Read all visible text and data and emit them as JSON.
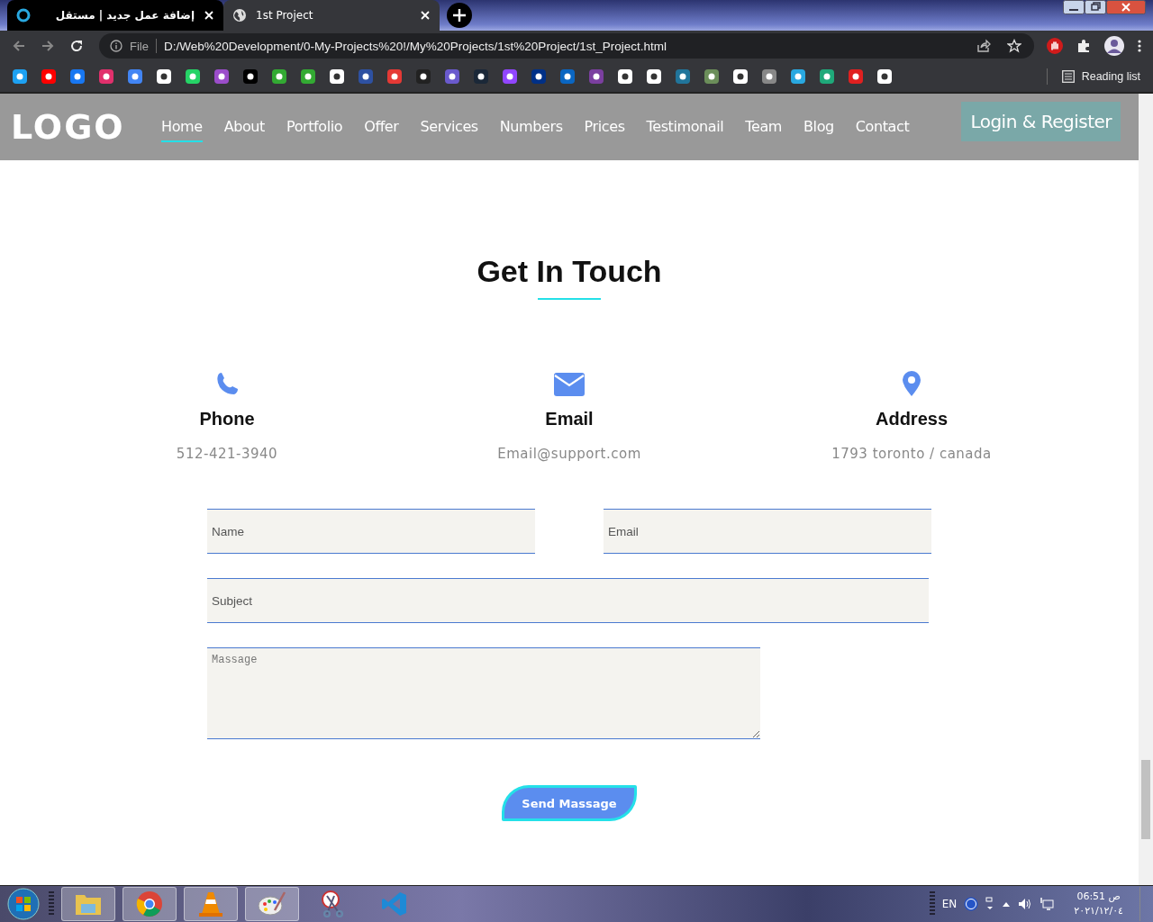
{
  "browser": {
    "tabs": [
      {
        "title": "إضافة عمل جديد | مستقل",
        "selected": false
      },
      {
        "title": "1st Project",
        "selected": true
      }
    ],
    "address": {
      "scheme": "File",
      "url": "D:/Web%20Development/0-My-Projects%20!/My%20Projects/1st%20Project/1st_Project.html"
    },
    "reading_list": "Reading list"
  },
  "nav": {
    "logo": "LOGO",
    "links": [
      {
        "label": "Home",
        "selected": true
      },
      {
        "label": "About",
        "selected": false
      },
      {
        "label": "Portfolio",
        "selected": false
      },
      {
        "label": "Offer",
        "selected": false
      },
      {
        "label": "Services",
        "selected": false
      },
      {
        "label": "Numbers",
        "selected": false
      },
      {
        "label": "Prices",
        "selected": false
      },
      {
        "label": "Testimonail",
        "selected": false
      },
      {
        "label": "Team",
        "selected": false
      },
      {
        "label": "Blog",
        "selected": false
      },
      {
        "label": "Contact",
        "selected": false
      }
    ],
    "login": "Login & Register"
  },
  "contact": {
    "title": "Get In Touch",
    "info": [
      {
        "kind": "phone",
        "title": "Phone",
        "value": "512-421-3940"
      },
      {
        "kind": "email",
        "title": "Email",
        "value": "Email@support.com"
      },
      {
        "kind": "address",
        "title": "Address",
        "value": "1793 toronto / canada"
      }
    ],
    "fields": [
      {
        "kind": "input",
        "placeholder": "Name"
      },
      {
        "kind": "input",
        "placeholder": "Email"
      },
      {
        "kind": "wide",
        "placeholder": "Subject"
      },
      {
        "kind": "textarea",
        "placeholder": "Massage"
      }
    ],
    "button": "Send Massage"
  },
  "taskbar": {
    "language": "EN",
    "time": "ص 06:51",
    "date": "٢٠٢١/١٢/٠٤"
  }
}
